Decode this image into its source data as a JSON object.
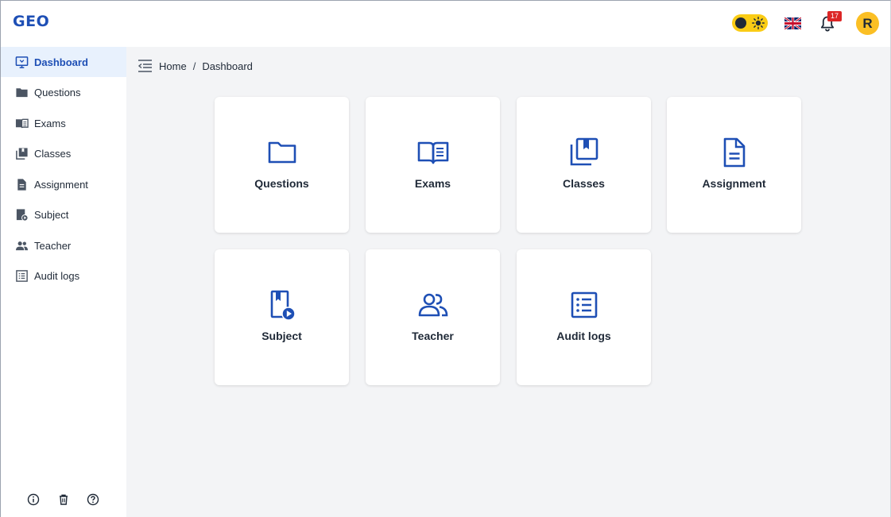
{
  "app": {
    "logo": "GEO"
  },
  "header": {
    "notifications_count": "17",
    "avatar_initial": "R",
    "language": "English (UK)"
  },
  "sidebar": {
    "items": [
      {
        "label": "Dashboard",
        "icon": "monitor-icon",
        "active": true
      },
      {
        "label": "Questions",
        "icon": "folder-icon"
      },
      {
        "label": "Exams",
        "icon": "book-open-icon"
      },
      {
        "label": "Classes",
        "icon": "library-icon"
      },
      {
        "label": "Assignment",
        "icon": "document-icon"
      },
      {
        "label": "Subject",
        "icon": "subject-video-icon"
      },
      {
        "label": "Teacher",
        "icon": "people-icon"
      },
      {
        "label": "Audit logs",
        "icon": "list-icon"
      }
    ],
    "bottom_icons": [
      "info-icon",
      "trash-icon",
      "help-icon"
    ]
  },
  "breadcrumb": {
    "home": "Home",
    "separator": "/",
    "current": "Dashboard"
  },
  "cards": [
    {
      "label": "Questions",
      "icon": "folder-icon"
    },
    {
      "label": "Exams",
      "icon": "book-open-icon"
    },
    {
      "label": "Classes",
      "icon": "library-icon"
    },
    {
      "label": "Assignment",
      "icon": "document-icon"
    },
    {
      "label": "Subject",
      "icon": "subject-video-icon"
    },
    {
      "label": "Teacher",
      "icon": "people-icon"
    },
    {
      "label": "Audit logs",
      "icon": "list-icon"
    }
  ],
  "colors": {
    "accent": "#1e4fb5",
    "active_bg": "#e8f1fd",
    "toggle": "#facc15",
    "badge": "#dc2626",
    "avatar": "#fbbf24",
    "background": "#f3f4f6"
  }
}
